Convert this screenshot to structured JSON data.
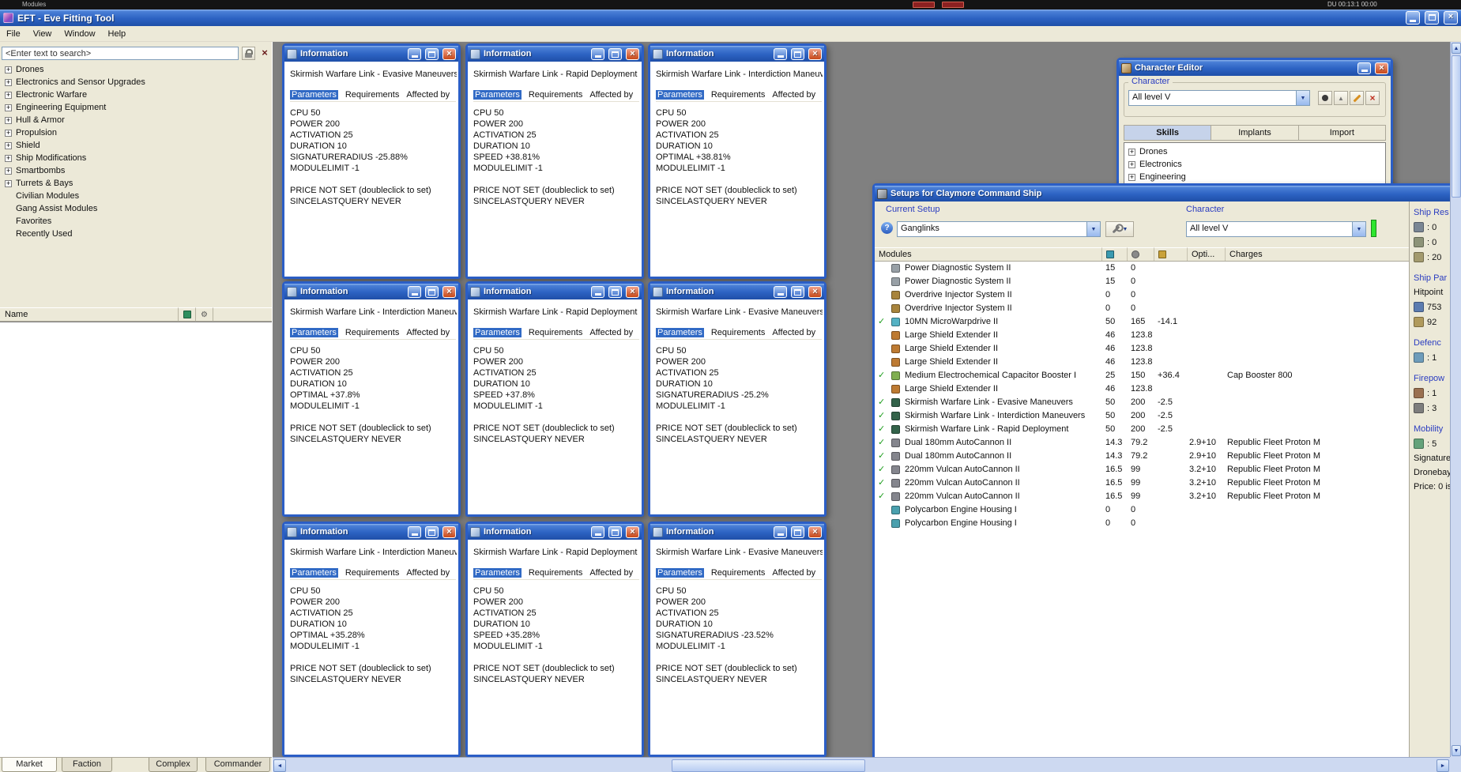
{
  "theme": {
    "titlebar_blue": "#2c62c2",
    "selected_tab_blue": "#316ac5",
    "close_red": "#c74818",
    "check_green": "#1e9e1e",
    "panel_beige": "#ece9d8",
    "desktop_gray": "#808080"
  },
  "background_strip": {
    "left_label": "Modules",
    "clock_label": "DU 00:13:1   00:00"
  },
  "app": {
    "title": "EFT - Eve Fitting Tool",
    "menu": [
      "File",
      "View",
      "Window",
      "Help"
    ]
  },
  "sidebar": {
    "search_placeholder": "<Enter text to search>",
    "name_header": "Name",
    "tree": [
      {
        "label": "Drones",
        "plus": true
      },
      {
        "label": "Electronics and Sensor Upgrades",
        "plus": true
      },
      {
        "label": "Electronic Warfare",
        "plus": true
      },
      {
        "label": "Engineering Equipment",
        "plus": true
      },
      {
        "label": "Hull & Armor",
        "plus": true
      },
      {
        "label": "Propulsion",
        "plus": true
      },
      {
        "label": "Shield",
        "plus": true
      },
      {
        "label": "Ship Modifications",
        "plus": true
      },
      {
        "label": "Smartbombs",
        "plus": true
      },
      {
        "label": "Turrets & Bays",
        "plus": true
      },
      {
        "label": "Civilian Modules",
        "plus": false
      },
      {
        "label": "Gang Assist Modules",
        "plus": false
      },
      {
        "label": "Favorites",
        "plus": false
      },
      {
        "label": "Recently Used",
        "plus": false
      }
    ],
    "bottom_tabs": [
      {
        "label": "Market",
        "cls": "active"
      },
      {
        "label": "Faction",
        "cls": ""
      },
      {
        "label": "Complex",
        "cls": ""
      },
      {
        "label": "Commander",
        "cls": ""
      }
    ]
  },
  "info_title": "Information",
  "info_tabs": [
    "Parameters",
    "Requirements",
    "Affected by"
  ],
  "info_windows": [
    {
      "subtitle": "Skirmish Warfare Link - Evasive Maneuvers",
      "body": "CPU 50\nPOWER 200\nACTIVATION 25\nDURATION 10\nSIGNATURERADIUS -25.88%\nMODULELIMIT -1\n\nPRICE NOT SET (doubleclick to set)\nSINCELASTQUERY NEVER"
    },
    {
      "subtitle": "Skirmish Warfare Link - Rapid Deployment",
      "body": "CPU 50\nPOWER 200\nACTIVATION 25\nDURATION 10\nSPEED +38.81%\nMODULELIMIT -1\n\nPRICE NOT SET (doubleclick to set)\nSINCELASTQUERY NEVER"
    },
    {
      "subtitle": "Skirmish Warfare Link - Interdiction Maneuvers",
      "body": "CPU 50\nPOWER 200\nACTIVATION 25\nDURATION 10\nOPTIMAL +38.81%\nMODULELIMIT -1\n\nPRICE NOT SET (doubleclick to set)\nSINCELASTQUERY NEVER"
    },
    {
      "subtitle": "Skirmish Warfare Link - Interdiction Maneuvers",
      "body": "CPU 50\nPOWER 200\nACTIVATION 25\nDURATION 10\nOPTIMAL +37.8%\nMODULELIMIT -1\n\nPRICE NOT SET (doubleclick to set)\nSINCELASTQUERY NEVER"
    },
    {
      "subtitle": "Skirmish Warfare Link - Rapid Deployment",
      "body": "CPU 50\nPOWER 200\nACTIVATION 25\nDURATION 10\nSPEED +37.8%\nMODULELIMIT -1\n\nPRICE NOT SET (doubleclick to set)\nSINCELASTQUERY NEVER"
    },
    {
      "subtitle": "Skirmish Warfare Link - Evasive Maneuvers",
      "body": "CPU 50\nPOWER 200\nACTIVATION 25\nDURATION 10\nSIGNATURERADIUS -25.2%\nMODULELIMIT -1\n\nPRICE NOT SET (doubleclick to set)\nSINCELASTQUERY NEVER"
    },
    {
      "subtitle": "Skirmish Warfare Link - Interdiction Maneuvers",
      "body": "CPU 50\nPOWER 200\nACTIVATION 25\nDURATION 10\nOPTIMAL +35.28%\nMODULELIMIT -1\n\nPRICE NOT SET (doubleclick to set)\nSINCELASTQUERY NEVER"
    },
    {
      "subtitle": "Skirmish Warfare Link - Rapid Deployment",
      "body": "CPU 50\nPOWER 200\nACTIVATION 25\nDURATION 10\nSPEED +35.28%\nMODULELIMIT -1\n\nPRICE NOT SET (doubleclick to set)\nSINCELASTQUERY NEVER"
    },
    {
      "subtitle": "Skirmish Warfare Link - Evasive Maneuvers",
      "body": "CPU 50\nPOWER 200\nACTIVATION 25\nDURATION 10\nSIGNATURERADIUS -23.52%\nMODULELIMIT -1\n\nPRICE NOT SET (doubleclick to set)\nSINCELASTQUERY NEVER"
    }
  ],
  "character_editor": {
    "title": "Character Editor",
    "group_label": "Character",
    "dropdown_value": "All level V",
    "tabs": [
      {
        "label": "Skills",
        "cls": "active"
      },
      {
        "label": "Implants",
        "cls": ""
      },
      {
        "label": "Import",
        "cls": ""
      }
    ],
    "tree": [
      {
        "label": "Drones",
        "plus": true
      },
      {
        "label": "Electronics",
        "plus": true
      },
      {
        "label": "Engineering",
        "plus": true
      }
    ]
  },
  "setups": {
    "title": "Setups for Claymore Command Ship",
    "current_setup_label": "Current Setup",
    "setup_value": "Ganglinks",
    "character_label": "Character",
    "character_value": "All level V",
    "columns": {
      "modules": "Modules",
      "opti": "Opti...",
      "charges": "Charges"
    },
    "modules": [
      {
        "check": false,
        "icon": "#98a0a6",
        "name": "Power Diagnostic System II",
        "cpu": "15",
        "pg": "0",
        "extra": "",
        "opti": "",
        "charge": ""
      },
      {
        "check": false,
        "icon": "#98a0a6",
        "name": "Power Diagnostic System II",
        "cpu": "15",
        "pg": "0",
        "extra": "",
        "opti": "",
        "charge": ""
      },
      {
        "check": false,
        "icon": "#a8843c",
        "name": "Overdrive Injector System II",
        "cpu": "0",
        "pg": "0",
        "extra": "",
        "opti": "",
        "charge": ""
      },
      {
        "check": false,
        "icon": "#a8843c",
        "name": "Overdrive Injector System II",
        "cpu": "0",
        "pg": "0",
        "extra": "",
        "opti": "",
        "charge": ""
      },
      {
        "check": true,
        "icon": "#54b2c4",
        "name": "10MN MicroWarpdrive II",
        "cpu": "50",
        "pg": "165",
        "extra": "-14.1",
        "opti": "",
        "charge": ""
      },
      {
        "check": false,
        "icon": "#bd7a32",
        "name": "Large Shield Extender II",
        "cpu": "46",
        "pg": "123.8",
        "extra": "",
        "opti": "",
        "charge": ""
      },
      {
        "check": false,
        "icon": "#bd7a32",
        "name": "Large Shield Extender II",
        "cpu": "46",
        "pg": "123.8",
        "extra": "",
        "opti": "",
        "charge": ""
      },
      {
        "check": false,
        "icon": "#bd7a32",
        "name": "Large Shield Extender II",
        "cpu": "46",
        "pg": "123.8",
        "extra": "",
        "opti": "",
        "charge": ""
      },
      {
        "check": true,
        "icon": "#7fae4f",
        "name": "Medium Electrochemical Capacitor Booster I",
        "cpu": "25",
        "pg": "150",
        "extra": "+36.4",
        "opti": "",
        "charge": "Cap Booster 800"
      },
      {
        "check": false,
        "icon": "#bd7a32",
        "name": "Large Shield Extender II",
        "cpu": "46",
        "pg": "123.8",
        "extra": "",
        "opti": "",
        "charge": ""
      },
      {
        "check": true,
        "icon": "#33634a",
        "name": "Skirmish Warfare Link - Evasive Maneuvers",
        "cpu": "50",
        "pg": "200",
        "extra": "-2.5",
        "opti": "",
        "charge": ""
      },
      {
        "check": true,
        "icon": "#33634a",
        "name": "Skirmish Warfare Link - Interdiction Maneuvers",
        "cpu": "50",
        "pg": "200",
        "extra": "-2.5",
        "opti": "",
        "charge": ""
      },
      {
        "check": true,
        "icon": "#33634a",
        "name": "Skirmish Warfare Link - Rapid Deployment",
        "cpu": "50",
        "pg": "200",
        "extra": "-2.5",
        "opti": "",
        "charge": ""
      },
      {
        "check": true,
        "icon": "#84858d",
        "name": "Dual 180mm AutoCannon II",
        "cpu": "14.3",
        "pg": "79.2",
        "extra": "",
        "opti": "2.9+10",
        "charge": "Republic Fleet Proton M"
      },
      {
        "check": true,
        "icon": "#84858d",
        "name": "Dual 180mm AutoCannon II",
        "cpu": "14.3",
        "pg": "79.2",
        "extra": "",
        "opti": "2.9+10",
        "charge": "Republic Fleet Proton M"
      },
      {
        "check": true,
        "icon": "#84858d",
        "name": "220mm Vulcan AutoCannon II",
        "cpu": "16.5",
        "pg": "99",
        "extra": "",
        "opti": "3.2+10",
        "charge": "Republic Fleet Proton M"
      },
      {
        "check": true,
        "icon": "#84858d",
        "name": "220mm Vulcan AutoCannon II",
        "cpu": "16.5",
        "pg": "99",
        "extra": "",
        "opti": "3.2+10",
        "charge": "Republic Fleet Proton M"
      },
      {
        "check": true,
        "icon": "#84858d",
        "name": "220mm Vulcan AutoCannon II",
        "cpu": "16.5",
        "pg": "99",
        "extra": "",
        "opti": "3.2+10",
        "charge": "Republic Fleet Proton M"
      },
      {
        "check": false,
        "icon": "#4aa0ae",
        "name": "Polycarbon Engine Housing I",
        "cpu": "0",
        "pg": "0",
        "extra": "",
        "opti": "",
        "charge": ""
      },
      {
        "check": false,
        "icon": "#4aa0ae",
        "name": "Polycarbon Engine Housing I",
        "cpu": "0",
        "pg": "0",
        "extra": "",
        "opti": "",
        "charge": ""
      }
    ],
    "stats": [
      {
        "cls": "shead",
        "icon": "",
        "text": "Ship Res"
      },
      {
        "cls": "srow",
        "icon": "#7a8694",
        "text": ": 0"
      },
      {
        "cls": "srow",
        "icon": "#8d9378",
        "text": ": 0"
      },
      {
        "cls": "srow",
        "icon": "#a39a6e",
        "text": ": 20"
      },
      {
        "cls": "shead",
        "icon": "",
        "text": "Ship Par"
      },
      {
        "cls": "ssub",
        "icon": "",
        "text": "Hitpoint"
      },
      {
        "cls": "srow",
        "icon": "#5c7cb0",
        "text": "753"
      },
      {
        "cls": "srow",
        "icon": "#b09a5c",
        "text": "92"
      },
      {
        "cls": "shead",
        "icon": "",
        "text": "Defenc"
      },
      {
        "cls": "srow",
        "icon": "#6e9cba",
        "text": ": 1"
      },
      {
        "cls": "shead",
        "icon": "",
        "text": "Firepow"
      },
      {
        "cls": "srow",
        "icon": "#9a7050",
        "text": ": 1"
      },
      {
        "cls": "srow",
        "icon": "#7d7d7d",
        "text": ": 3"
      },
      {
        "cls": "shead",
        "icon": "",
        "text": "Mobility"
      },
      {
        "cls": "srow",
        "icon": "#64a27a",
        "text": ": 5"
      },
      {
        "cls": "ssub",
        "icon": "",
        "text": "Signature"
      },
      {
        "cls": "ssub",
        "icon": "",
        "text": "Dronebay"
      },
      {
        "cls": "ssub",
        "icon": "",
        "text": "Price: 0 is"
      }
    ]
  }
}
